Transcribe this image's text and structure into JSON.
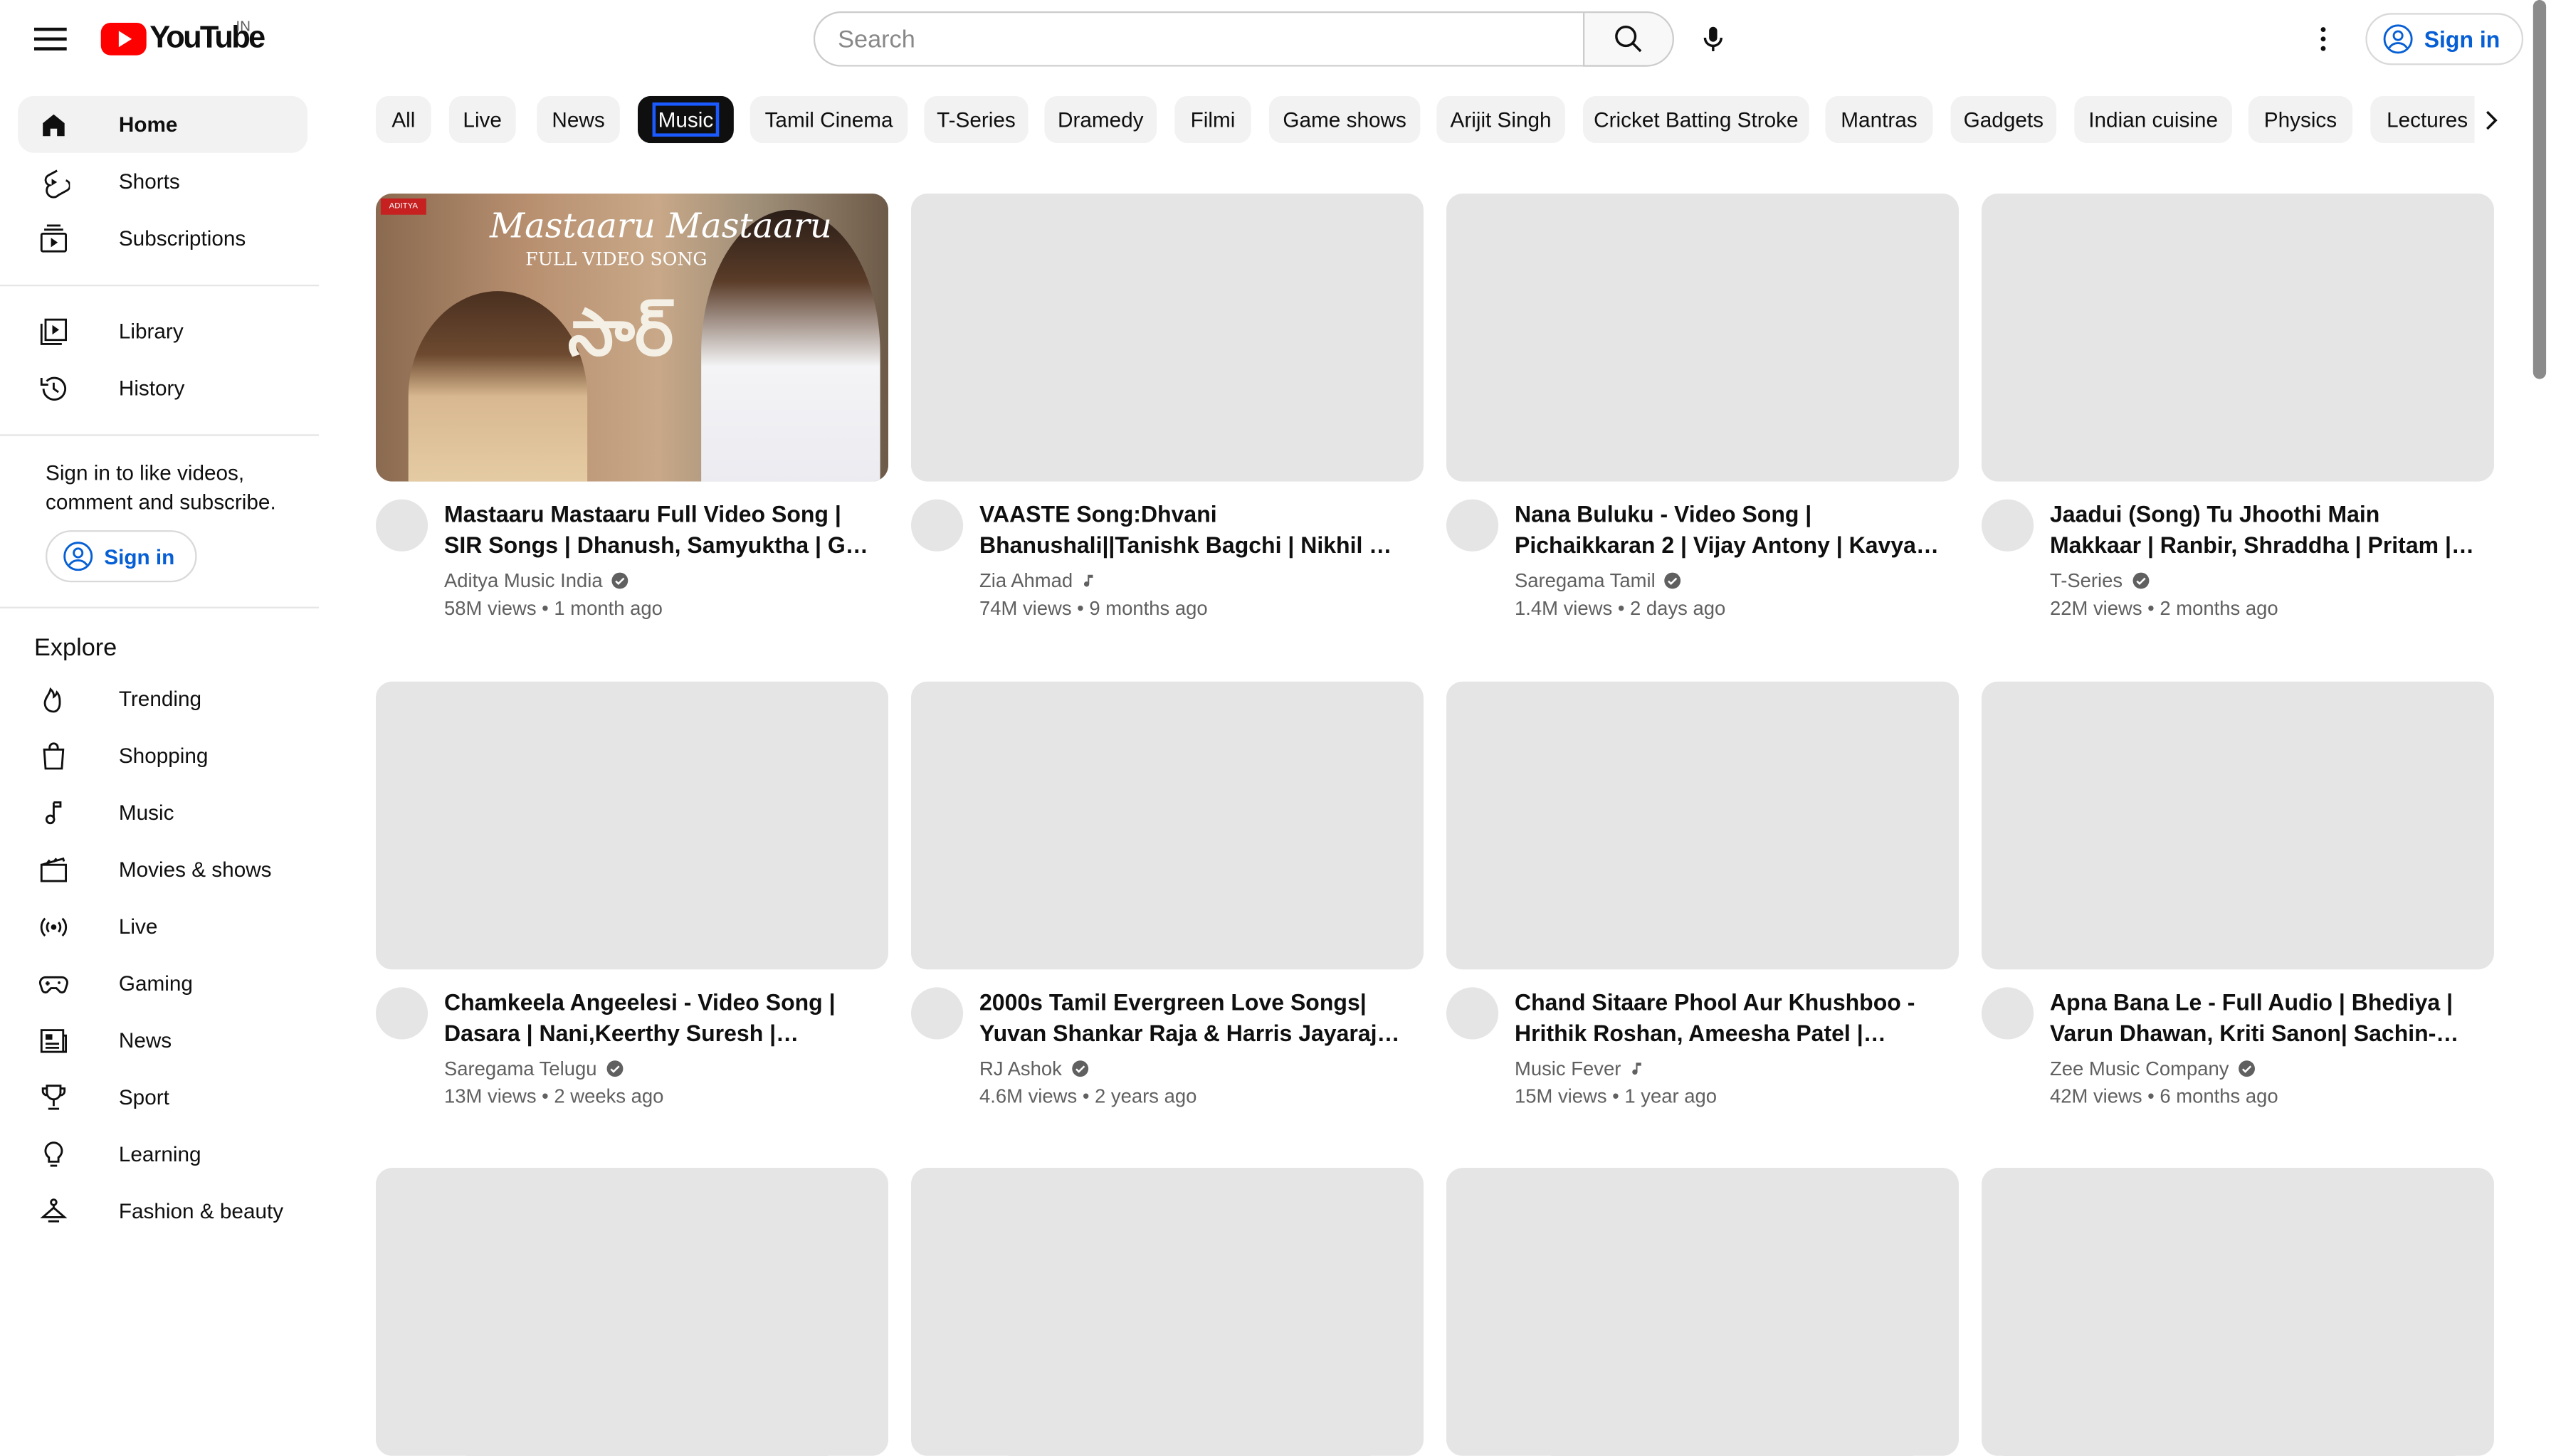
{
  "header": {
    "logo_text": "YouTube",
    "country_code": "IN",
    "search_placeholder": "Search",
    "signin_label": "Sign in"
  },
  "sidebar": {
    "primary": [
      {
        "label": "Home",
        "icon": "home-icon"
      },
      {
        "label": "Shorts",
        "icon": "shorts-icon"
      },
      {
        "label": "Subscriptions",
        "icon": "subscriptions-icon"
      }
    ],
    "secondary": [
      {
        "label": "Library",
        "icon": "library-icon"
      },
      {
        "label": "History",
        "icon": "history-icon"
      }
    ],
    "signin_prompt": "Sign in to like videos, comment and subscribe.",
    "signin_label": "Sign in",
    "explore_heading": "Explore",
    "explore": [
      {
        "label": "Trending",
        "icon": "trending-icon"
      },
      {
        "label": "Shopping",
        "icon": "shopping-icon"
      },
      {
        "label": "Music",
        "icon": "music-icon"
      },
      {
        "label": "Movies & shows",
        "icon": "movies-icon"
      },
      {
        "label": "Live",
        "icon": "live-icon"
      },
      {
        "label": "Gaming",
        "icon": "gaming-icon"
      },
      {
        "label": "News",
        "icon": "news-icon"
      },
      {
        "label": "Sport",
        "icon": "sport-icon"
      },
      {
        "label": "Learning",
        "icon": "learning-icon"
      },
      {
        "label": "Fashion & beauty",
        "icon": "fashion-icon"
      }
    ]
  },
  "chips": [
    "All",
    "Live",
    "News",
    "Music",
    "Tamil Cinema",
    "T-Series",
    "Dramedy",
    "Filmi",
    "Game shows",
    "Arijit Singh",
    "Cricket Batting Stroke",
    "Mantras",
    "Gadgets",
    "Indian cuisine",
    "Physics",
    "Lectures"
  ],
  "active_chip": "Music",
  "featured_thumb": {
    "badge": "ADITYA",
    "line1": "Mastaaru Mastaaru",
    "line2": "FULL VIDEO SONG",
    "line3": "సార్"
  },
  "videos": [
    {
      "title": "Mastaaru Mastaaru Full Video Song | SIR Songs | Dhanush, Samyuktha | GV Prakash Kumar",
      "channel": "Aditya Music India",
      "badge": "verified",
      "views": "58M views",
      "age": "1 month ago"
    },
    {
      "title": "VAASTE Song:Dhvani Bhanushali||Tanishk Bagchi | Nikhil D | Bhushan Kumar",
      "channel": "Zia Ahmad",
      "badge": "music-note",
      "views": "74M views",
      "age": "9 months ago"
    },
    {
      "title": "Nana Buluku - Video Song | Pichaikkaran 2 | Vijay Antony | Kavya Thapar",
      "channel": "Saregama Tamil",
      "badge": "verified",
      "views": "1.4M views",
      "age": "2 days ago"
    },
    {
      "title": "Jaadui (Song) Tu Jhoothi Main Makkaar | Ranbir, Shraddha | Pritam | Jubin Nautiyal",
      "channel": "T-Series",
      "badge": "verified",
      "views": "22M views",
      "age": "2 months ago"
    },
    {
      "title": "Chamkeela Angeelesi - Video Song | Dasara | Nani,Keerthy Suresh | Santhosh Narayanan",
      "channel": "Saregama Telugu",
      "badge": "verified",
      "views": "13M views",
      "age": "2 weeks ago"
    },
    {
      "title": "2000s Tamil Evergreen Love Songs| Yuvan Shankar Raja & Harris Jayaraj Hits",
      "channel": "RJ Ashok",
      "badge": "verified",
      "views": "4.6M views",
      "age": "2 years ago"
    },
    {
      "title": "Chand Sitaare Phool Aur Khushboo - Hrithik Roshan, Ameesha Patel | Kumar Sanu",
      "channel": "Music Fever",
      "badge": "music-note",
      "views": "15M views",
      "age": "1 year ago"
    },
    {
      "title": "Apna Bana Le - Full Audio | Bhediya | Varun Dhawan, Kriti Sanon| Sachin-Jigar",
      "channel": "Zee Music Company",
      "badge": "verified",
      "views": "42M views",
      "age": "6 months ago"
    }
  ],
  "colors": {
    "brand_red": "#ff0000",
    "link_blue": "#065fd4",
    "placeholder_gray": "#e5e5e5"
  }
}
